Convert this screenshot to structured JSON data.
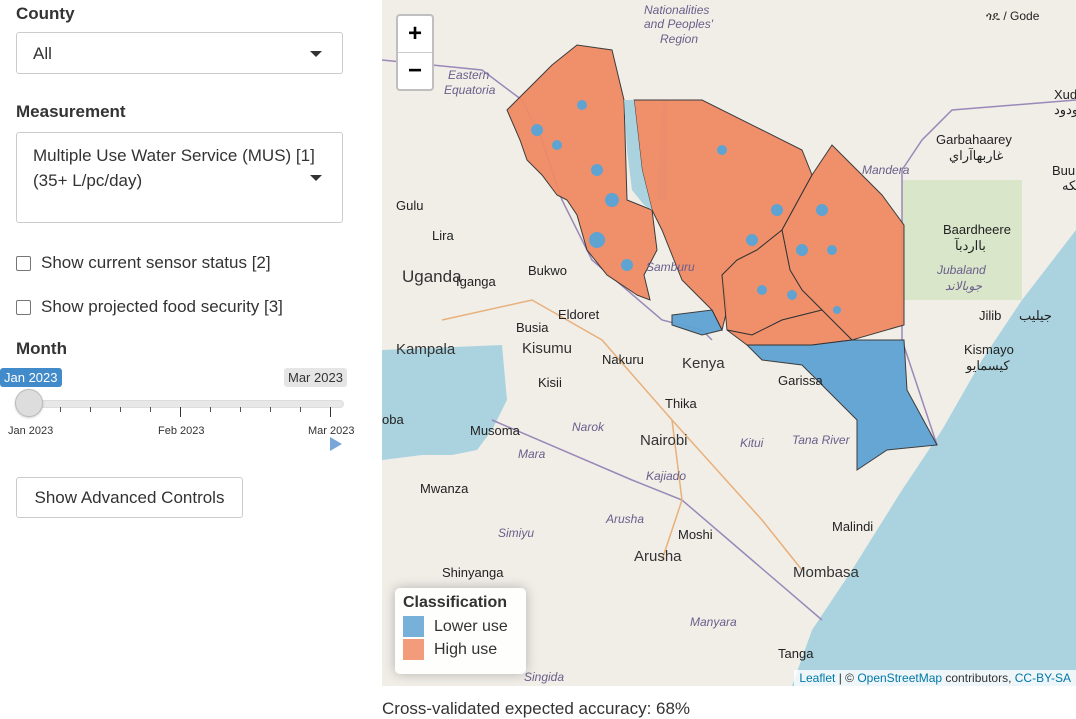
{
  "sidebar": {
    "county": {
      "label": "County",
      "value": "All"
    },
    "measurement": {
      "label": "Measurement",
      "value_line1": "Multiple Use Water Service (MUS) [1]",
      "value_line2": "(35+ L/pc/day)"
    },
    "checkboxes": [
      {
        "label": "Show current sensor status [2]",
        "checked": false
      },
      {
        "label": "Show projected food security [3]",
        "checked": false
      }
    ],
    "month": {
      "label": "Month",
      "selected": "Jan 2023",
      "max_label": "Mar 2023",
      "ticks": [
        "Jan 2023",
        "Feb 2023",
        "Mar 2023"
      ],
      "value_fraction": 0
    },
    "advanced_button": "Show Advanced Controls"
  },
  "map": {
    "zoom_in": "+",
    "zoom_out": "−",
    "legend": {
      "title": "Classification",
      "items": [
        {
          "label": "Lower use",
          "color": "#5fa3d3"
        },
        {
          "label": "High use",
          "color": "#f08b65"
        }
      ]
    },
    "attribution": {
      "leaflet": "Leaflet",
      "sep": " | © ",
      "osm": "OpenStreetMap",
      "contrib": " contributors, ",
      "license": "CC-BY-SA"
    },
    "places": {
      "uganda": "Uganda",
      "kampala": "Kampala",
      "kenya": "Kenya",
      "nairobi": "Nairobi",
      "mombasa": "Mombasa",
      "arusha": "Arusha",
      "eldoret": "Eldoret",
      "kisumu": "Kisumu",
      "nakuru": "Nakuru",
      "garissa": "Garissa",
      "malindi": "Malindi",
      "moshi": "Moshi",
      "tanga": "Tanga",
      "kismayo": "Kismayo",
      "kismayo_ar": "كيسمايو",
      "jilib": "Jilib",
      "jilib_ar": "جيليب",
      "bardhere": "Baardheere",
      "bardhere_ar": "بااردبآ",
      "garbahaarey": "Garbahaarey",
      "garbahaarey_ar": "غاربهاآراي",
      "gulu": "Gulu",
      "lira": "Lira",
      "iganga": "Iganga",
      "bukwo": "Bukwo",
      "busia": "Busia",
      "kisii": "Kisii",
      "thika": "Thika",
      "musoma": "Musoma",
      "mwanza": "Mwanza",
      "shinyanga": "Shinyanga",
      "jubaland": "Jubaland",
      "jubaland_ar": "جوبالاند",
      "mandera": "Mandera",
      "eastern_equatoria_1": "Eastern",
      "eastern_equatoria_2": "Equatoria",
      "nationalities_1": "Nationalities",
      "nationalities_2": "and Peoples'",
      "nationalities_3": "Region",
      "samburu": "Samburu",
      "narok": "Narok",
      "kajiado": "Kajiado",
      "kitui": "Kitui",
      "tana_river": "Tana River",
      "mara": "Mara",
      "simiyu": "Simiyu",
      "manyara": "Manyara",
      "singida": "Singida",
      "gode": "ጎዴ / Gode",
      "xudun": "Xudu",
      "xudun_ar": "ودود",
      "buurh": "Buurh",
      "buurh_ar": "لكه",
      "oba": "oba"
    }
  },
  "footer": {
    "accuracy": "Cross-validated expected accuracy: 68%"
  }
}
